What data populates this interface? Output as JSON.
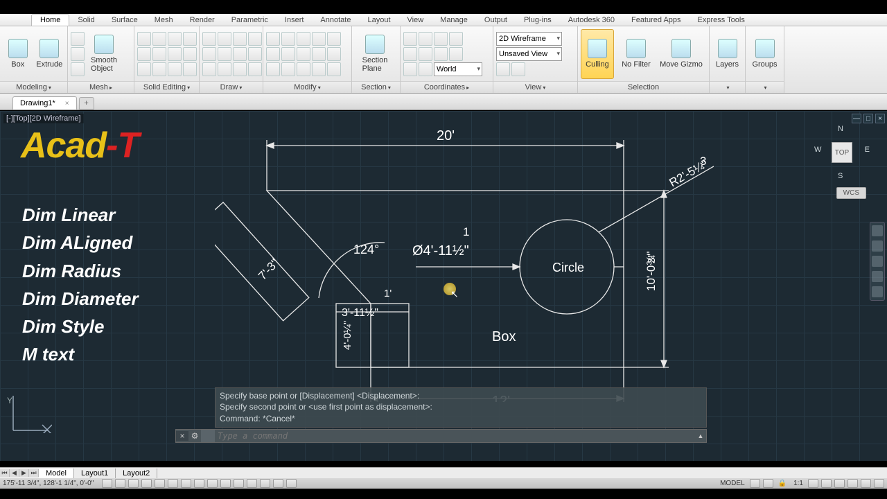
{
  "tabs": [
    "Home",
    "Solid",
    "Surface",
    "Mesh",
    "Render",
    "Parametric",
    "Insert",
    "Annotate",
    "Layout",
    "View",
    "Manage",
    "Output",
    "Plug-ins",
    "Autodesk 360",
    "Featured Apps",
    "Express Tools"
  ],
  "activeTab": "Home",
  "panels": {
    "modeling": {
      "title": "Modeling",
      "big": [
        {
          "label": "Box"
        },
        {
          "label": "Extrude"
        }
      ]
    },
    "mesh": {
      "title": "Mesh",
      "big": [
        {
          "label": "Smooth\nObject"
        }
      ]
    },
    "solidEditing": {
      "title": "Solid Editing"
    },
    "draw": {
      "title": "Draw"
    },
    "modify": {
      "title": "Modify"
    },
    "section": {
      "title": "Section",
      "big": [
        {
          "label": "Section\nPlane"
        }
      ]
    },
    "coordinates": {
      "title": "Coordinates",
      "world": "World"
    },
    "view": {
      "title": "View",
      "visual": "2D Wireframe",
      "saved": "Unsaved View"
    },
    "selection": {
      "title": "Selection",
      "items": [
        "Culling",
        "No Filter",
        "Move Gizmo"
      ]
    },
    "layers": {
      "title": "",
      "label": "Layers"
    },
    "groups": {
      "title": "",
      "label": "Groups"
    }
  },
  "fileTab": {
    "name": "Drawing1*"
  },
  "viewport": {
    "label": "[-][Top][2D Wireframe]"
  },
  "viewcube": {
    "face": "TOP",
    "n": "N",
    "s": "S",
    "e": "E",
    "w": "W",
    "wcs": "WCS"
  },
  "logo": {
    "a": "Acad",
    "b": "-T"
  },
  "features": [
    "Dim Linear",
    "Dim ALigned",
    "Dim Radius",
    "Dim Diameter",
    "Dim Style",
    "M text"
  ],
  "annotations": {
    "top": "20'",
    "aligned": "7'-3\"",
    "angle": "124°",
    "boxw": "3'-11½\"",
    "boxh": "4'-0¼\"",
    "small1": "1'",
    "dia": "Ø4'-11½\"",
    "dia1": "1",
    "circle": "Circle",
    "box": "Box",
    "right": "10'-0¾\"",
    "rightSmall": "3\"",
    "bottom": "12'",
    "radius": "R2'-5¼\"",
    "rad3": "3"
  },
  "cmd": {
    "l1": "Specify base point or [Displacement] <Displacement>:",
    "l2": "Specify second point or <use first point as displacement>:",
    "l3": "Command: *Cancel*",
    "placeholder": "Type a command"
  },
  "layoutTabs": [
    "Model",
    "Layout1",
    "Layout2"
  ],
  "status": {
    "coords": "175'-11 3/4\", 128'-1 1/4\", 0'-0\"",
    "model": "MODEL",
    "scale": "1:1"
  },
  "ucs": {
    "y": "Y",
    "x": "X"
  }
}
